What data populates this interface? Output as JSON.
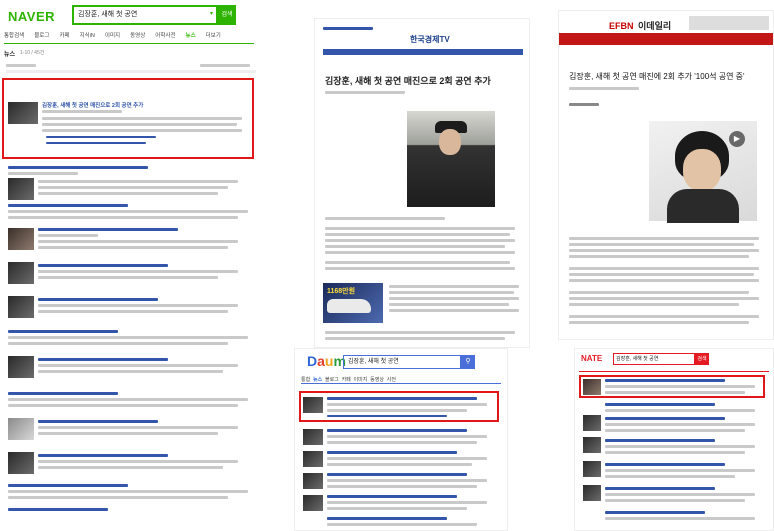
{
  "naver": {
    "logo": "NAVER",
    "search_query": "김장훈, 새해 첫 공연",
    "search_button": "검색",
    "tabs": [
      {
        "label": "통합검색",
        "active": false
      },
      {
        "label": "블로그",
        "active": false
      },
      {
        "label": "카페",
        "active": false
      },
      {
        "label": "지식iN",
        "active": false
      },
      {
        "label": "이미지",
        "active": false
      },
      {
        "label": "동영상",
        "active": false
      },
      {
        "label": "어학사전",
        "active": false
      },
      {
        "label": "뉴스",
        "active": true
      },
      {
        "label": "더보기",
        "active": false
      }
    ],
    "section_label": "뉴스",
    "result_count": "1-10 / 45건",
    "highlighted_result_title": "김장훈, 새해 첫 공연 매진으로 2회 공연 추가"
  },
  "hankyung": {
    "brand": "한국경제TV",
    "headline": "김장훈, 새해 첫 공연 매진으로 2회 공연 추가",
    "ad_label": "1168만원"
  },
  "edaily": {
    "brand_part1": "이데일리",
    "brand_part2": "",
    "brand_prefix": "EFBN",
    "headline": "김장훈, 새해 첫 공연 매진에 2회 추가 '100석 공연 중'"
  },
  "daum": {
    "logo": "Daum",
    "search_query": "김장훈, 새해 첫 공연",
    "search_button_icon": "search-icon",
    "tabs": [
      "통합",
      "뉴스",
      "블로그",
      "카페",
      "이미지",
      "동영상",
      "사전"
    ]
  },
  "nate": {
    "logo": "NATE",
    "search_query": "김장훈, 새해 첫 공연",
    "search_button": "검색"
  },
  "colors": {
    "highlight": "#e01818",
    "naver_green": "#2db400",
    "daum_blue": "#4a6fd8",
    "nate_red": "#e51b23",
    "link_blue": "#3355aa"
  }
}
